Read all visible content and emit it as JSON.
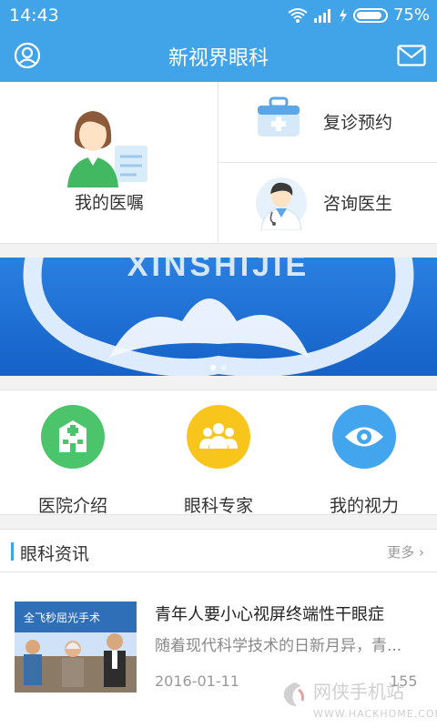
{
  "status_bar": {
    "time": "14:43",
    "battery": "75%"
  },
  "app_bar": {
    "title": "新视界眼科"
  },
  "top_grid": {
    "advice_label": "我的医嘱",
    "followup_label": "复诊预约",
    "consult_label": "咨询医生"
  },
  "banner": {
    "text": "XINSHIJIE",
    "slide_count": 2,
    "active_slide": 1
  },
  "quick_links": [
    {
      "label": "医院介绍",
      "icon": "hospital-icon",
      "color": "#4cc46c"
    },
    {
      "label": "眼科专家",
      "icon": "people-icon",
      "color": "#f7c51c"
    },
    {
      "label": "我的视力",
      "icon": "eye-icon",
      "color": "#42a5ee"
    }
  ],
  "news": {
    "section_title": "眼科资讯",
    "more_label": "更多",
    "items": [
      {
        "headline": "青年人要小心视屏终端性干眼症",
        "summary": "随着现代科学技术的日新月异，青...",
        "date": "2016-01-11",
        "count": "155",
        "thumb_caption": "全飞秒屈光手术"
      }
    ]
  },
  "watermark": {
    "name": "网侠手机站",
    "url": "WWW.HACKHOME.COM"
  },
  "colors": {
    "primary": "#41a3e8",
    "green": "#4cc46c",
    "yellow": "#f7c51c",
    "blue": "#42a5ee"
  }
}
